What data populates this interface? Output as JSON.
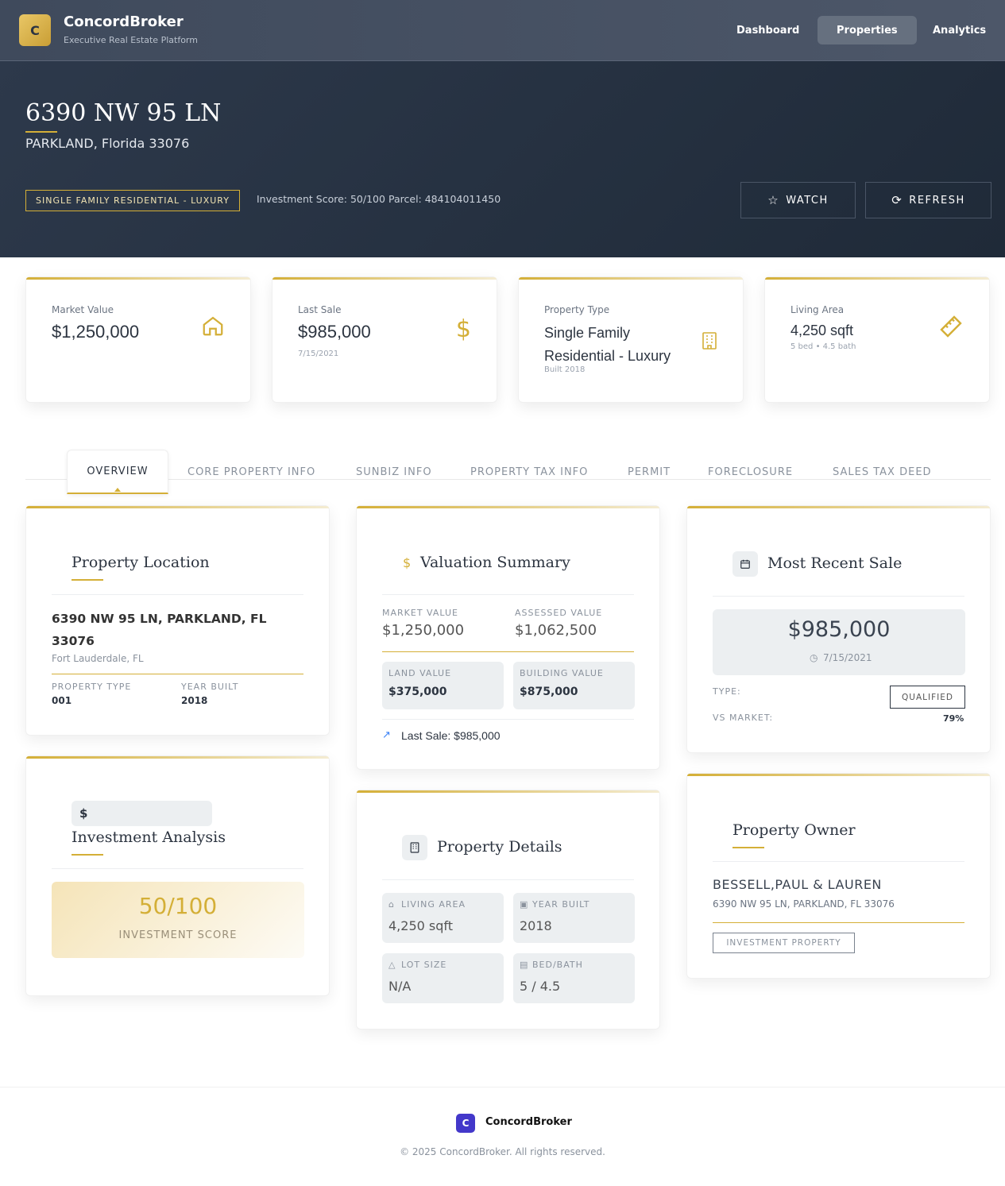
{
  "nav": {
    "logo_letter": "C",
    "brand": "ConcordBroker",
    "tagline": "Executive Real Estate Platform",
    "links": [
      "Dashboard",
      "Properties",
      "Analytics"
    ],
    "active": "Properties"
  },
  "hero": {
    "address": "6390 NW 95 LN",
    "city_line": "PARKLAND, Florida 33076",
    "type_badge": "SINGLE FAMILY RESIDENTIAL - LUXURY",
    "investment_score": "Investment Score: 50/100",
    "parcel": "Parcel: 484104011450",
    "watch_label": "WATCH",
    "refresh_label": "REFRESH"
  },
  "stats": [
    {
      "label": "Market Value",
      "value": "$1,250,000",
      "note": "",
      "icon": "home-icon"
    },
    {
      "label": "Last Sale",
      "value": "$985,000",
      "note": "7/15/2021",
      "icon": "dollar-icon"
    },
    {
      "label": "Property Type",
      "value": "Single Family Residential - Luxury",
      "note": "Built 2018",
      "icon": "building-icon"
    },
    {
      "label": "Living Area",
      "value": "4,250 sqft",
      "note": "5 bed • 4.5 bath",
      "icon": "ruler-icon"
    }
  ],
  "tabs": [
    "OVERVIEW",
    "CORE PROPERTY INFO",
    "SUNBIZ INFO",
    "PROPERTY TAX INFO",
    "PERMIT",
    "FORECLOSURE",
    "SALES TAX DEED"
  ],
  "location": {
    "title": "Property Location",
    "address": "6390 NW 95 LN, PARKLAND, FL 33076",
    "area": "Fort Lauderdale, FL",
    "type_label": "PROPERTY TYPE",
    "type_value": "001",
    "year_label": "YEAR BUILT",
    "year_value": "2018"
  },
  "investment": {
    "title": "Investment Analysis",
    "icon_text": "$",
    "score": "50/100",
    "score_label": "INVESTMENT SCORE"
  },
  "valuation": {
    "title": "Valuation Summary",
    "market_label": "MARKET VALUE",
    "market_value": "$1,250,000",
    "assessed_label": "ASSESSED VALUE",
    "assessed_value": "$1,062,500",
    "land_label": "LAND VALUE",
    "land_value": "$375,000",
    "building_label": "BUILDING VALUE",
    "building_value": "$875,000",
    "last_sale": "Last Sale: $985,000"
  },
  "details": {
    "title": "Property Details",
    "living_label": "LIVING AREA",
    "living_value": "4,250 sqft",
    "year_label": "YEAR BUILT",
    "year_value": "2018",
    "lot_label": "LOT SIZE",
    "lot_value": "N/A",
    "bedbath_label": "BED/BATH",
    "bedbath_value": "5 / 4.5"
  },
  "sale": {
    "title": "Most Recent Sale",
    "price": "$985,000",
    "date": "7/15/2021",
    "type_label": "TYPE:",
    "type_badge": "QUALIFIED",
    "vs_label": "VS MARKET:",
    "vs_value": "79%"
  },
  "owner": {
    "title": "Property Owner",
    "name": "BESSELL,PAUL & LAUREN",
    "address": "6390 NW 95 LN, PARKLAND, FL 33076",
    "badge": "INVESTMENT PROPERTY"
  },
  "footer": {
    "logo_letter": "C",
    "brand": "ConcordBroker",
    "copyright": "© 2025 ConcordBroker. All rights reserved."
  },
  "colors": {
    "accent": "#d4af37",
    "hero": "#1f2a38",
    "footer_logo": "#4338ca"
  }
}
